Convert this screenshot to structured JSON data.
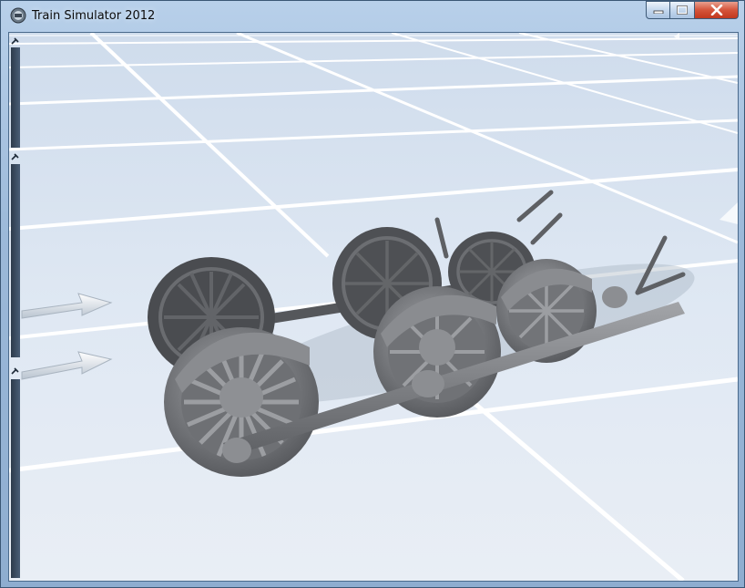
{
  "window": {
    "title": "Train Simulator 2012",
    "caption_buttons": [
      "minimize",
      "maximize",
      "close"
    ]
  },
  "viewport": {
    "subject": "steam-locomotive-wheelset-model",
    "ground": "blue-white-grid-floor",
    "arrows": [
      "direction-arrow",
      "direction-arrow"
    ]
  },
  "colors": {
    "title_bar": "#9cb9d9",
    "close_button": "#c94a30",
    "floor": "#dbe6f2",
    "grid_lines": "#ffffff",
    "model_metal": "#7a7c80"
  }
}
